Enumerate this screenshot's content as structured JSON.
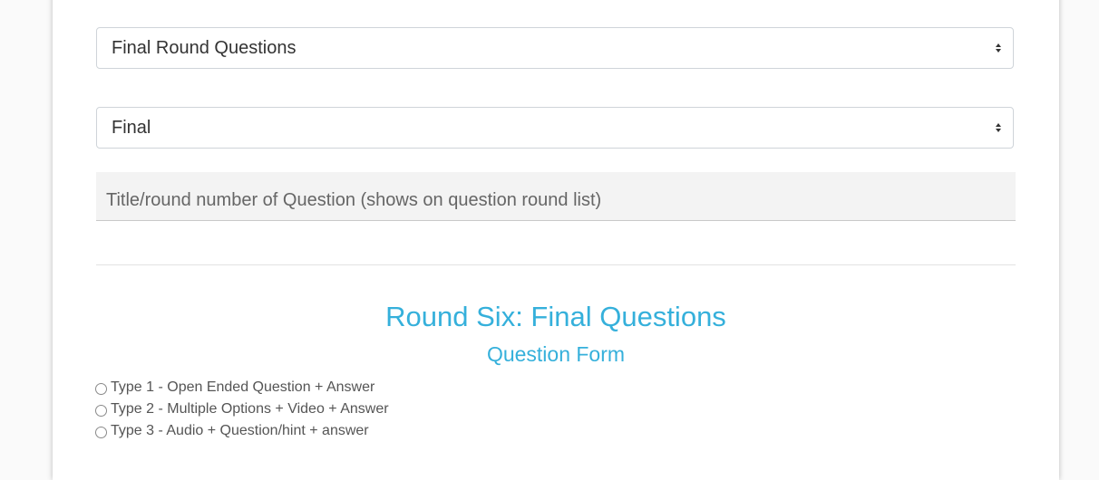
{
  "form": {
    "category_select": {
      "selected": "Final Round Questions"
    },
    "round_select": {
      "selected": "Final"
    },
    "title_input": {
      "value": "",
      "placeholder": "Title/round number of Question (shows on question round list)"
    },
    "round_title": "Round Six: Final Questions",
    "subtitle": "Question Form",
    "question_types": [
      {
        "label": "Type 1 - Open Ended Question + Answer"
      },
      {
        "label": "Type 2 - Multiple Options + Video + Answer"
      },
      {
        "label": "Type 3 - Audio + Question/hint + answer"
      }
    ]
  },
  "colors": {
    "accent": "#35b0db",
    "border": "#cfd4d9",
    "input_bg": "#f3f3f3"
  },
  "icons": {
    "select_caret": "updown-caret-icon",
    "radio": "radio-circle-icon"
  }
}
